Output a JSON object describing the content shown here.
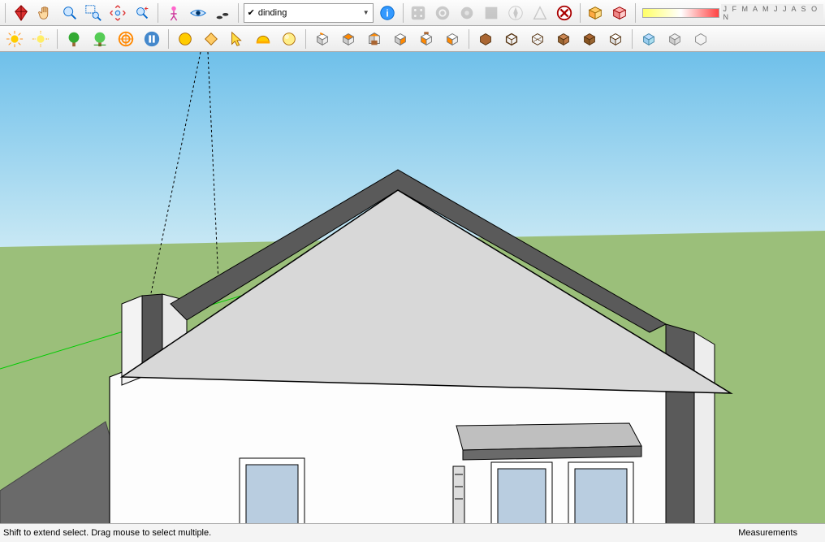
{
  "layer_dropdown": {
    "label": "dinding",
    "checked": true
  },
  "status": {
    "hint": "Shift to extend select. Drag mouse to select multiple.",
    "measurements_label": "Measurements"
  },
  "months": "J F M A M J J A S O N",
  "toolbar1": [
    {
      "name": "kite-icon",
      "alt": "Select"
    },
    {
      "name": "hand-icon",
      "alt": "Pan"
    },
    {
      "name": "magnifier-icon",
      "alt": "Zoom"
    },
    {
      "name": "zoom-window-icon",
      "alt": "Zoom Window"
    },
    {
      "name": "zoom-extents-icon",
      "alt": "Zoom Extents"
    },
    {
      "name": "zoom-prev-icon",
      "alt": "Previous"
    },
    {
      "name": "person-icon",
      "alt": "Position Camera"
    },
    {
      "name": "eye-icon",
      "alt": "Look Around"
    },
    {
      "name": "walk-icon",
      "alt": "Walk"
    }
  ],
  "toolbar1b": [
    {
      "name": "dice-icon"
    },
    {
      "name": "gear-icon"
    },
    {
      "name": "gear2-icon"
    },
    {
      "name": "gear3-icon"
    },
    {
      "name": "compass-icon"
    },
    {
      "name": "triangle-icon"
    },
    {
      "name": "x-icon"
    }
  ],
  "toolbar1c": [
    {
      "name": "box1-icon"
    },
    {
      "name": "box2-icon"
    }
  ],
  "toolbar2": [
    {
      "name": "sun1-icon"
    },
    {
      "name": "sun2-icon"
    },
    {
      "name": "tree1-icon"
    },
    {
      "name": "tree2-icon"
    },
    {
      "name": "target-icon"
    },
    {
      "name": "pause-icon"
    }
  ],
  "toolbar2b": [
    {
      "name": "ball-icon"
    },
    {
      "name": "diamond-icon"
    },
    {
      "name": "cursor-icon"
    },
    {
      "name": "helmet-icon"
    },
    {
      "name": "ball2-icon"
    }
  ],
  "toolbar2c": [
    {
      "name": "iso-icon"
    },
    {
      "name": "top-icon"
    },
    {
      "name": "front-icon"
    },
    {
      "name": "right-icon"
    },
    {
      "name": "back-icon"
    },
    {
      "name": "left-icon"
    }
  ],
  "toolbar2d": [
    {
      "name": "style1-icon"
    },
    {
      "name": "style2-icon"
    },
    {
      "name": "style3-icon"
    },
    {
      "name": "style4-icon"
    },
    {
      "name": "style5-icon"
    },
    {
      "name": "style6-icon"
    }
  ],
  "toolbar2e": [
    {
      "name": "render1-icon"
    },
    {
      "name": "render2-icon"
    },
    {
      "name": "render3-icon"
    }
  ]
}
